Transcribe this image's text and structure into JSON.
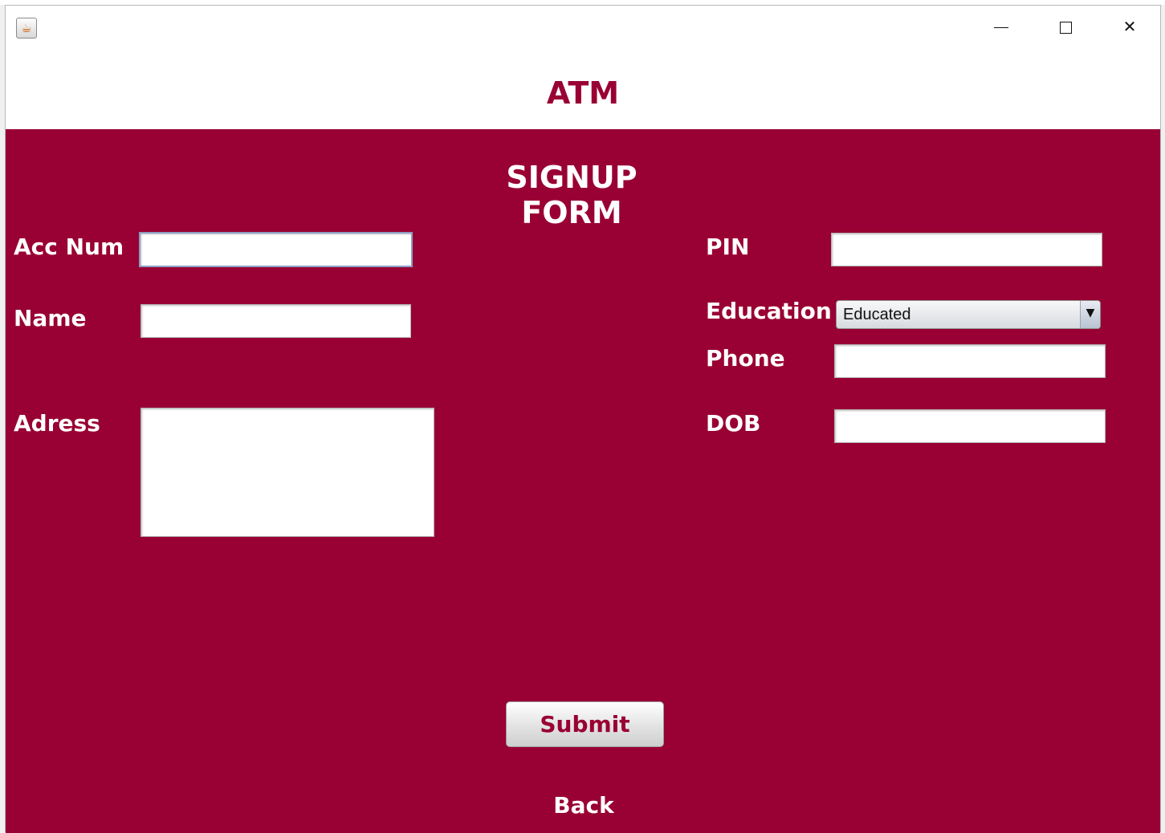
{
  "window": {
    "app_icon": "java-coffee-icon",
    "controls": {
      "minimize": "minimize-icon",
      "maximize": "maximize-icon",
      "close": "close-icon",
      "close_glyph": "✕"
    }
  },
  "header": {
    "title": "ATM"
  },
  "form": {
    "title": "SIGNUP FORM",
    "fields": {
      "acc_num": {
        "label": "Acc Num",
        "value": ""
      },
      "name": {
        "label": "Name",
        "value": ""
      },
      "address": {
        "label": "Adress",
        "value": ""
      },
      "pin": {
        "label": "PIN",
        "value": ""
      },
      "education": {
        "label": "Education",
        "selected": "Educated",
        "arrow": "▼"
      },
      "phone": {
        "label": "Phone",
        "value": ""
      },
      "dob": {
        "label": "DOB",
        "value": ""
      }
    },
    "submit_label": "Submit",
    "back_label": "Back"
  },
  "colors": {
    "primary": "#990033",
    "text_on_primary": "#ffffff"
  }
}
